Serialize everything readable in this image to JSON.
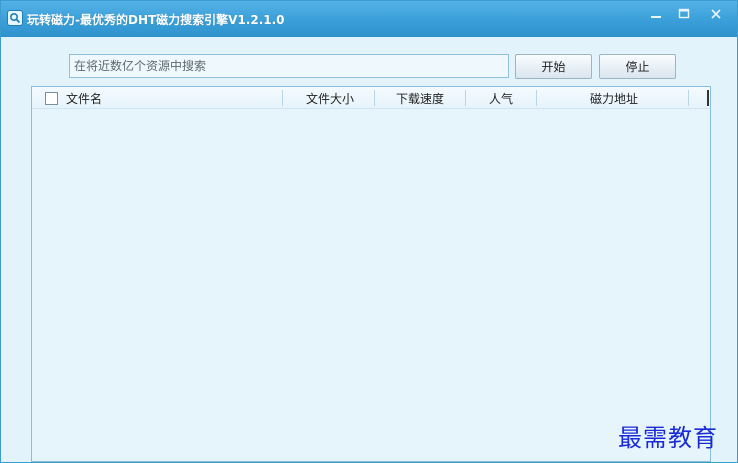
{
  "window": {
    "title": "玩转磁力-最优秀的DHT磁力搜索引擎V1.2.1.0",
    "icons": {
      "app": "magnet-search-icon",
      "minimize": "minimize-icon",
      "maximize": "maximize-icon",
      "close": "close-icon"
    }
  },
  "search": {
    "placeholder": "在将近数亿个资源中搜索",
    "value": ""
  },
  "toolbar": {
    "start_label": "开始",
    "stop_label": "停止"
  },
  "results": {
    "columns": [
      {
        "label": "文件名"
      },
      {
        "label": "文件大小"
      },
      {
        "label": "下载速度"
      },
      {
        "label": "人气"
      },
      {
        "label": "磁力地址"
      }
    ],
    "select_all_checked": false,
    "rows": []
  },
  "watermark": "最需教育",
  "colors": {
    "titlebar": "#3a9fd8",
    "window_bg": "#e3f3fb",
    "border": "#88bddb",
    "watermark": "#1a2bd6"
  }
}
